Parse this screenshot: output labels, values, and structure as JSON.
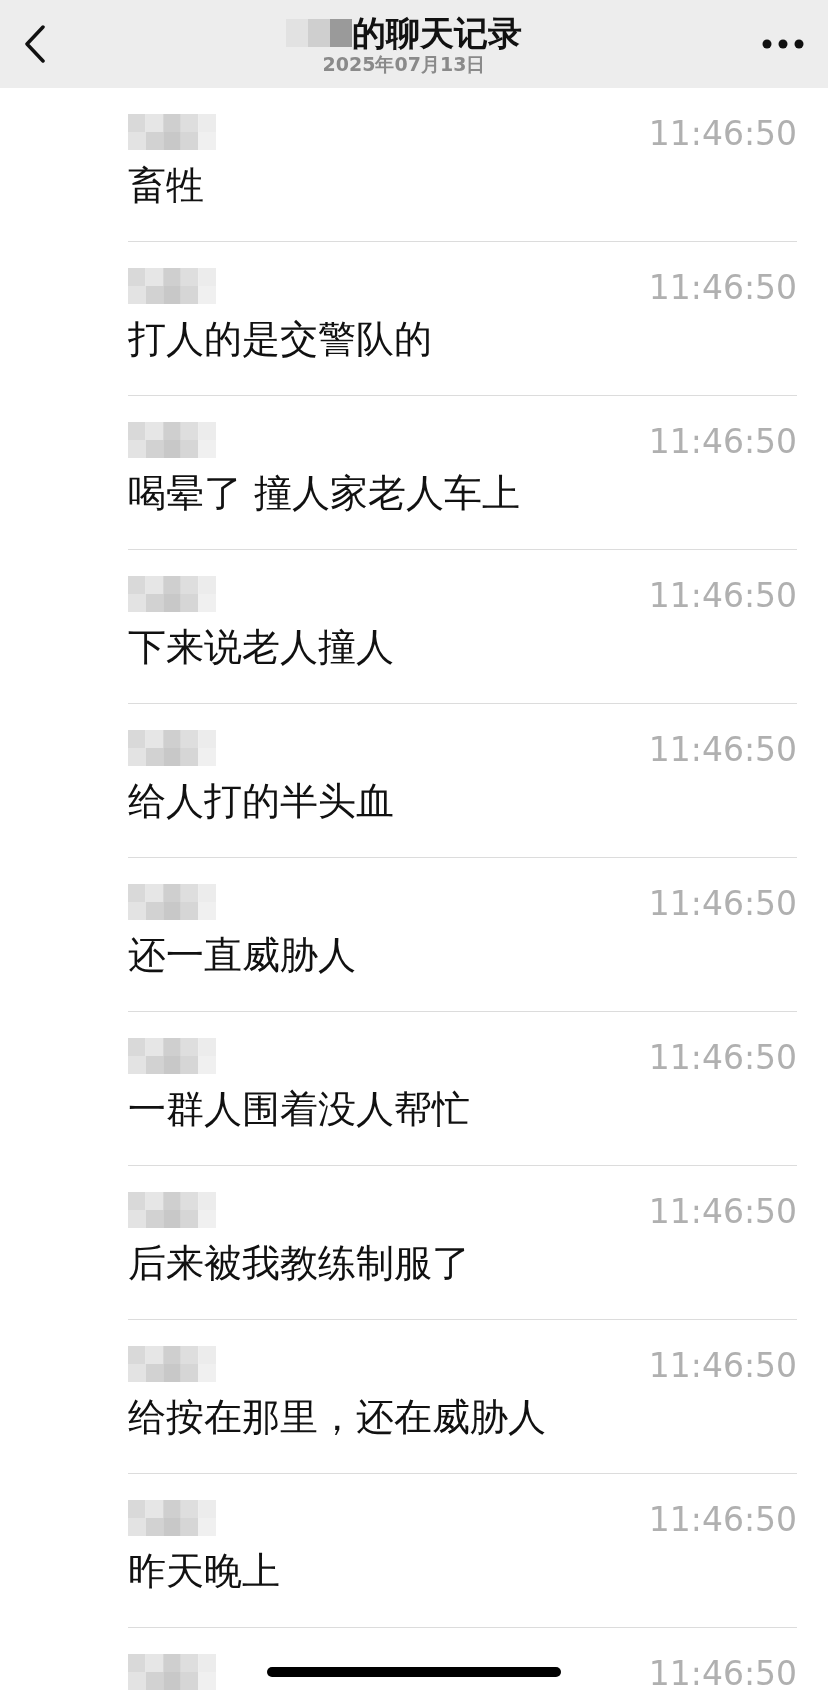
{
  "header": {
    "title": "的聊天记录",
    "date": "2025年07月13日"
  },
  "messages": [
    {
      "time": "11:46:50",
      "text": "畜牲"
    },
    {
      "time": "11:46:50",
      "text": "打人的是交警队的"
    },
    {
      "time": "11:46:50",
      "text": "喝晕了 撞人家老人车上"
    },
    {
      "time": "11:46:50",
      "text": "下来说老人撞人"
    },
    {
      "time": "11:46:50",
      "text": "给人打的半头血"
    },
    {
      "time": "11:46:50",
      "text": "还一直威胁人"
    },
    {
      "time": "11:46:50",
      "text": "一群人围着没人帮忙"
    },
    {
      "time": "11:46:50",
      "text": "后来被我教练制服了"
    },
    {
      "time": "11:46:50",
      "text": "给按在那里，还在威胁人"
    },
    {
      "time": "11:46:50",
      "text": "昨天晚上"
    },
    {
      "time": "11:46:50"
    }
  ]
}
